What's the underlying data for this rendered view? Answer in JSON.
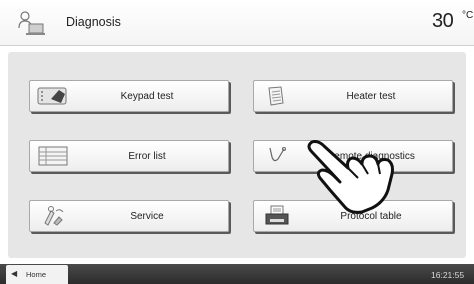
{
  "header": {
    "title": "Diagnosis",
    "temperature": "30",
    "temperature_unit": "°C",
    "icon": "person-monitor-icon"
  },
  "buttons": [
    {
      "label": "Keypad test",
      "icon": "keypad-icon"
    },
    {
      "label": "Heater test",
      "icon": "heater-icon"
    },
    {
      "label": "Error list",
      "icon": "list-icon"
    },
    {
      "label": "Remote diagnostics",
      "icon": "stethoscope-icon"
    },
    {
      "label": "Service",
      "icon": "service-tools-icon"
    },
    {
      "label": "Protocol table",
      "icon": "printer-icon"
    }
  ],
  "footer": {
    "home_label": "Home",
    "home_arrow": "◀",
    "time": "16:21:55"
  },
  "overlay": {
    "icon": "pointing-hand-icon"
  }
}
